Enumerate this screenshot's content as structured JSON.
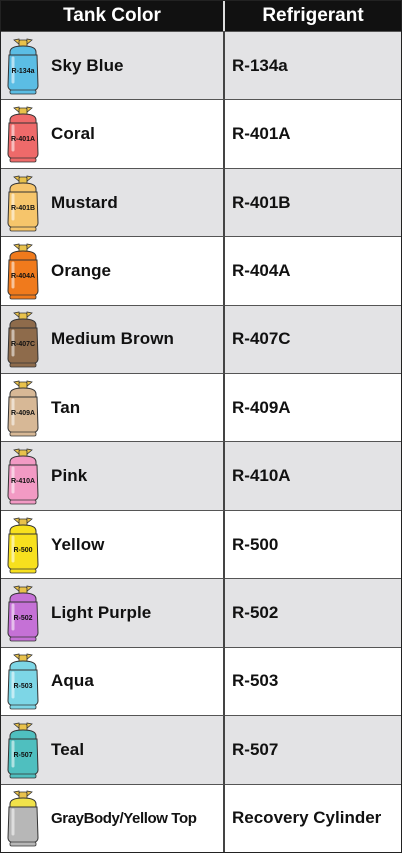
{
  "header": {
    "tank_color": "Tank Color",
    "refrigerant": "Refrigerant"
  },
  "rows": [
    {
      "color_name": "Sky Blue",
      "refrigerant": "R-134a",
      "tank_label": "R-134a",
      "body": "#5bbde4",
      "top": "#5bbde4",
      "valve": "#e9c24b"
    },
    {
      "color_name": "Coral",
      "refrigerant": "R-401A",
      "tank_label": "R-401A",
      "body": "#ee6a6a",
      "top": "#ee6a6a",
      "valve": "#e9c24b"
    },
    {
      "color_name": "Mustard",
      "refrigerant": "R-401B",
      "tank_label": "R-401B",
      "body": "#f6c56b",
      "top": "#f6c56b",
      "valve": "#e9c24b"
    },
    {
      "color_name": "Orange",
      "refrigerant": "R-404A",
      "tank_label": "R-404A",
      "body": "#f07a1c",
      "top": "#f07a1c",
      "valve": "#e9c24b"
    },
    {
      "color_name": "Medium Brown",
      "refrigerant": "R-407C",
      "tank_label": "R-407C",
      "body": "#8e6b4b",
      "top": "#8e6b4b",
      "valve": "#e9c24b"
    },
    {
      "color_name": "Tan",
      "refrigerant": "R-409A",
      "tank_label": "R-409A",
      "body": "#d7b896",
      "top": "#d7b896",
      "valve": "#e9c24b"
    },
    {
      "color_name": "Pink",
      "refrigerant": "R-410A",
      "tank_label": "R-410A",
      "body": "#f29ac4",
      "top": "#f29ac4",
      "valve": "#e9c24b"
    },
    {
      "color_name": "Yellow",
      "refrigerant": "R-500",
      "tank_label": "R-500",
      "body": "#f7e01e",
      "top": "#f7e01e",
      "valve": "#e9c24b"
    },
    {
      "color_name": "Light Purple",
      "refrigerant": "R-502",
      "tank_label": "R-502",
      "body": "#c571d6",
      "top": "#c571d6",
      "valve": "#e9c24b"
    },
    {
      "color_name": "Aqua",
      "refrigerant": "R-503",
      "tank_label": "R-503",
      "body": "#7dd6e6",
      "top": "#7dd6e6",
      "valve": "#e9c24b"
    },
    {
      "color_name": "Teal",
      "refrigerant": "R-507",
      "tank_label": "R-507",
      "body": "#4fbfbf",
      "top": "#4fbfbf",
      "valve": "#e9c24b"
    },
    {
      "color_name": "GrayBody/Yellow Top",
      "refrigerant": "Recovery Cylinder",
      "tank_label": "",
      "body": "#b7b7b7",
      "top": "#f1e24a",
      "valve": "#e9c24b"
    }
  ]
}
